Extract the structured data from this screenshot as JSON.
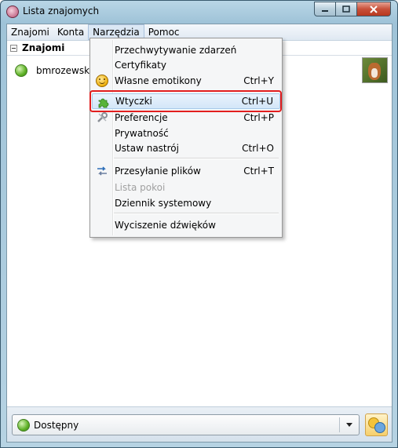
{
  "window": {
    "title": "Lista znajomych",
    "controls": [
      "minimize",
      "maximize",
      "close"
    ]
  },
  "menubar": {
    "items": [
      {
        "label": "Znajomi"
      },
      {
        "label": "Konta"
      },
      {
        "label": "Narzędzia"
      },
      {
        "label": "Pomoc"
      }
    ]
  },
  "buddy_list": {
    "group": "Znajomi",
    "buddy": {
      "name": "bmrozewski@"
    }
  },
  "tools_menu": {
    "items": [
      {
        "label": "Przechwytywanie zdarzeń",
        "shortcut": ""
      },
      {
        "label": "Certyfikaty",
        "shortcut": ""
      },
      {
        "label": "Własne emotikony",
        "shortcut": "Ctrl+Y",
        "icon": "smiley-icon"
      },
      {
        "label": "Wtyczki",
        "shortcut": "Ctrl+U",
        "icon": "puzzle-icon",
        "highlighted": true
      },
      {
        "label": "Preferencje",
        "shortcut": "Ctrl+P",
        "icon": "settings-icon"
      },
      {
        "label": "Prywatność",
        "shortcut": ""
      },
      {
        "label": "Ustaw nastrój",
        "shortcut": "Ctrl+O"
      },
      {
        "label": "Przesyłanie plików",
        "shortcut": "Ctrl+T",
        "icon": "file-transfer-icon"
      },
      {
        "label": "Lista pokoi",
        "shortcut": "",
        "disabled": true
      },
      {
        "label": "Dziennik systemowy",
        "shortcut": ""
      },
      {
        "label": "Wyciszenie dźwięków",
        "shortcut": ""
      }
    ]
  },
  "status_bar": {
    "status": "Dostępny"
  },
  "colors": {
    "highlight_frame": "#e21e1e",
    "available_green": "#5eb126"
  }
}
